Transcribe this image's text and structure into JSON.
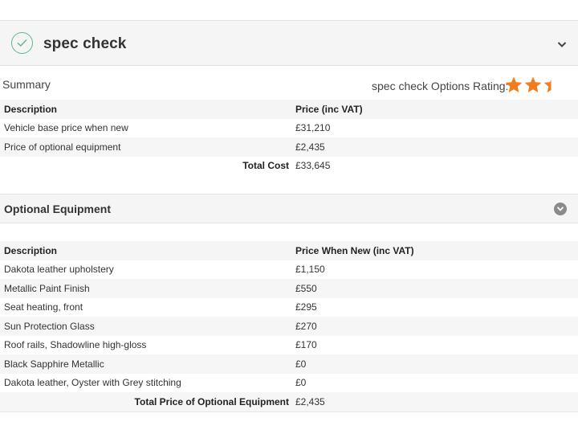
{
  "header": {
    "title": "spec check",
    "check_icon": "check-circle-icon",
    "toggle_icon": "chevron-down-icon"
  },
  "summary": {
    "label": "Summary",
    "rating_label": "spec check Options Rating:",
    "rating_value": 2.5,
    "rating_max": 3,
    "star_color": "#f07c1e",
    "columns": {
      "description": "Description",
      "price": "Price (inc VAT)"
    },
    "rows": [
      {
        "description": "Vehicle base price when new",
        "price": "£31,210"
      },
      {
        "description": "Price of optional equipment",
        "price": "£2,435"
      }
    ],
    "total": {
      "label": "Total Cost",
      "value": "£33,645"
    }
  },
  "optional": {
    "title": "Optional Equipment",
    "toggle_icon": "chevron-down-circle-icon",
    "columns": {
      "description": "Description",
      "price": "Price When New (inc VAT)"
    },
    "rows": [
      {
        "description": "Dakota leather upholstery",
        "price": "£1,150"
      },
      {
        "description": "Metallic Paint Finish",
        "price": "£550"
      },
      {
        "description": "Seat heating, front",
        "price": "£295"
      },
      {
        "description": "Sun Protection Glass",
        "price": "£270"
      },
      {
        "description": "Roof rails, Shadowline high-gloss",
        "price": "£170"
      },
      {
        "description": "Black Sapphire Metallic",
        "price": "£0"
      },
      {
        "description": "Dakota leather, Oyster with Grey stitching",
        "price": "£0"
      }
    ],
    "total": {
      "label": "Total Price of Optional Equipment",
      "value": "£2,435"
    }
  },
  "colors": {
    "accent_green": "#5cb88a",
    "header_bg": "#f5f5f5",
    "star_orange": "#f07c1e"
  }
}
